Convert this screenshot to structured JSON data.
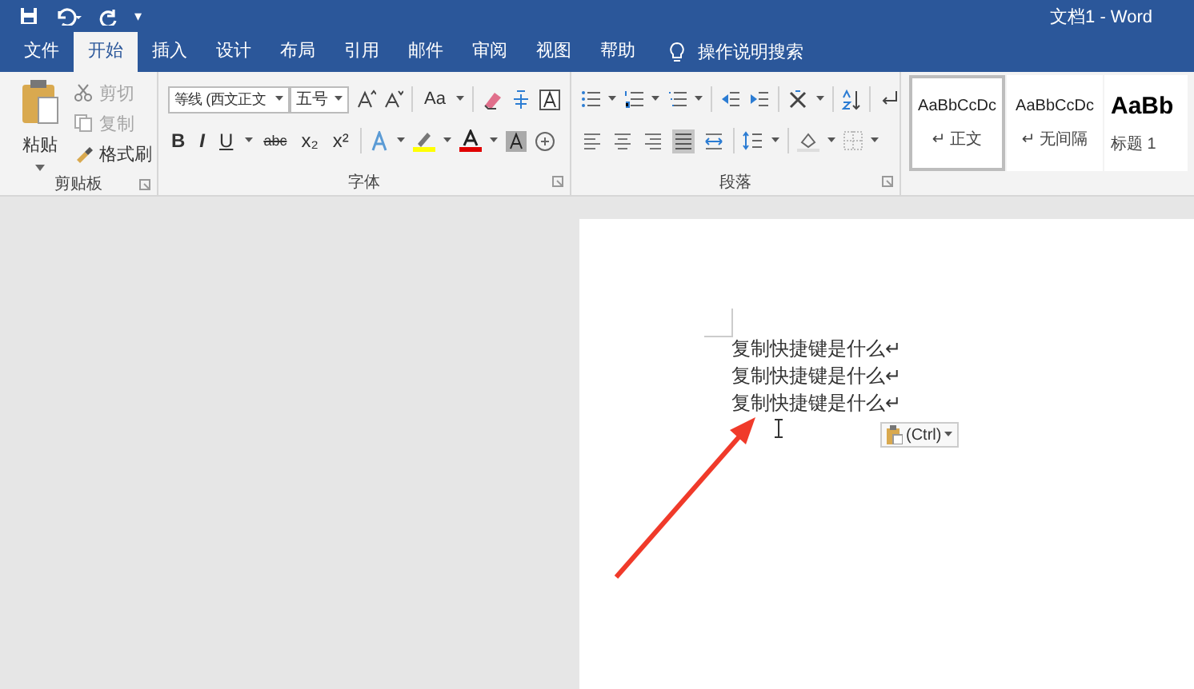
{
  "window": {
    "title": "文档1  -  Word",
    "quick_access_more": "▾"
  },
  "tabs": [
    {
      "label": "文件",
      "selected": false
    },
    {
      "label": "开始",
      "selected": true
    },
    {
      "label": "插入",
      "selected": false
    },
    {
      "label": "设计",
      "selected": false
    },
    {
      "label": "布局",
      "selected": false
    },
    {
      "label": "引用",
      "selected": false
    },
    {
      "label": "邮件",
      "selected": false
    },
    {
      "label": "审阅",
      "selected": false
    },
    {
      "label": "视图",
      "selected": false
    },
    {
      "label": "帮助",
      "selected": false
    }
  ],
  "search": {
    "label": "操作说明搜索"
  },
  "clipboard": {
    "label": "剪贴板",
    "paste": "粘贴",
    "commands": [
      {
        "label": "剪切",
        "disabled": true
      },
      {
        "label": "复制",
        "disabled": true
      },
      {
        "label": "格式刷",
        "disabled": false
      }
    ]
  },
  "font": {
    "label": "字体",
    "font_name": "等线 (西文正文",
    "font_size": "五号",
    "case_button": "Aa",
    "format_buttons": [
      {
        "label": "B",
        "kind": "bold"
      },
      {
        "label": "I",
        "kind": "italic"
      },
      {
        "label": "U",
        "kind": "underline"
      },
      {
        "label": "abc",
        "kind": "strike"
      },
      {
        "label": "x₂",
        "kind": "plain"
      },
      {
        "label": "x²",
        "kind": "plain"
      }
    ]
  },
  "paragraph": {
    "label": "段落",
    "alignments": [
      {
        "kind": "left",
        "selected": false
      },
      {
        "kind": "center",
        "selected": false
      },
      {
        "kind": "right",
        "selected": false
      },
      {
        "kind": "justify",
        "selected": true
      },
      {
        "kind": "distributed",
        "selected": false
      }
    ]
  },
  "styles": [
    {
      "preview": "AaBbCcDc",
      "name": "↵ 正文",
      "kind": "small",
      "selected": true
    },
    {
      "preview": "AaBbCcDc",
      "name": "↵ 无间隔",
      "kind": "small",
      "selected": false
    },
    {
      "preview": "AaBb",
      "name": "标题 1",
      "kind": "large",
      "selected": false
    }
  ],
  "document": {
    "lines": [
      "复制快捷键是什么↵",
      "复制快捷键是什么↵",
      "复制快捷键是什么↵"
    ],
    "paste_options": "(Ctrl)"
  }
}
